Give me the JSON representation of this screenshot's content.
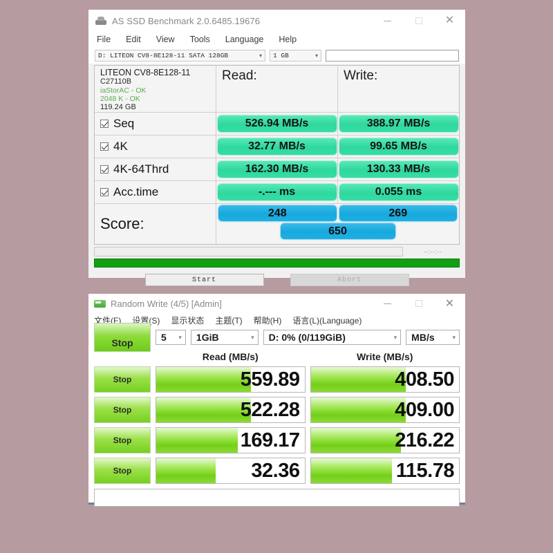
{
  "as_ssd": {
    "title": "AS SSD Benchmark 2.0.6485.19676",
    "title_icon": "drive-icon",
    "window_controls": {
      "minimize": "minimize-icon",
      "maximize": "maximize-icon",
      "close": "close-icon"
    },
    "menu": [
      "File",
      "Edit",
      "View",
      "Tools",
      "Language",
      "Help"
    ],
    "toolbar": {
      "drive_select": "D: LITEON CV8-8E128-11 SATA 128GB",
      "size_select": "1 GB",
      "text_field_value": "",
      "text_field_placeholder": ""
    },
    "device": {
      "model": "LITEON CV8-8E128-11",
      "firmware": "C27110B",
      "driver": "iaStorAC - OK",
      "alignment": "2048 K - OK",
      "capacity": "119.24 GB"
    },
    "columns": {
      "read": "Read:",
      "write": "Write:"
    },
    "rows": [
      {
        "label": "Seq",
        "checked": true,
        "read": "526.94 MB/s",
        "write": "388.97 MB/s"
      },
      {
        "label": "4K",
        "checked": true,
        "read": "32.77 MB/s",
        "write": "99.65 MB/s"
      },
      {
        "label": "4K-64Thrd",
        "checked": true,
        "read": "162.30 MB/s",
        "write": "130.33 MB/s"
      },
      {
        "label": "Acc.time",
        "checked": true,
        "read": "-.--- ms",
        "write": "0.055 ms"
      }
    ],
    "score": {
      "label": "Score:",
      "read": "248",
      "write": "269",
      "total": "650"
    },
    "eta": "--:--:--",
    "buttons": {
      "start": "Start",
      "abort": "Abort"
    },
    "colors": {
      "bar_green": "#2fd89d",
      "bar_blue": "#17a8dd",
      "progress_green": "#12a012",
      "ok_text": "#5aab4e"
    }
  },
  "cdm": {
    "title": "Random Write (4/5) [Admin]",
    "title_icon": "disk-icon",
    "window_controls": {
      "minimize": "minimize-icon",
      "maximize": "maximize-icon",
      "close": "close-icon"
    },
    "menu": [
      "文件(F)",
      "设置(S)",
      "显示状态",
      "主题(T)",
      "帮助(H)",
      "语言(L)(Language)"
    ],
    "toolbar": {
      "stop_label": "Stop",
      "count": "5",
      "size": "1GiB",
      "target": "D: 0% (0/119GiB)",
      "unit": "MB/s"
    },
    "columns": {
      "read": "Read (MB/s)",
      "write": "Write (MB/s)"
    },
    "rows": [
      {
        "stop_label": "Stop",
        "read": "559.89",
        "write": "408.50",
        "read_pct": 64,
        "write_pct": 64
      },
      {
        "stop_label": "Stop",
        "read": "522.28",
        "write": "409.00",
        "read_pct": 64,
        "write_pct": 64
      },
      {
        "stop_label": "Stop",
        "read": "169.17",
        "write": "216.22",
        "read_pct": 55,
        "write_pct": 61
      },
      {
        "stop_label": "Stop",
        "read": "32.36",
        "write": "115.78",
        "read_pct": 40,
        "write_pct": 55
      }
    ],
    "status_text": "",
    "colors": {
      "bar_green": "#74cf1a",
      "stop_button": "#8ddc3a"
    }
  }
}
